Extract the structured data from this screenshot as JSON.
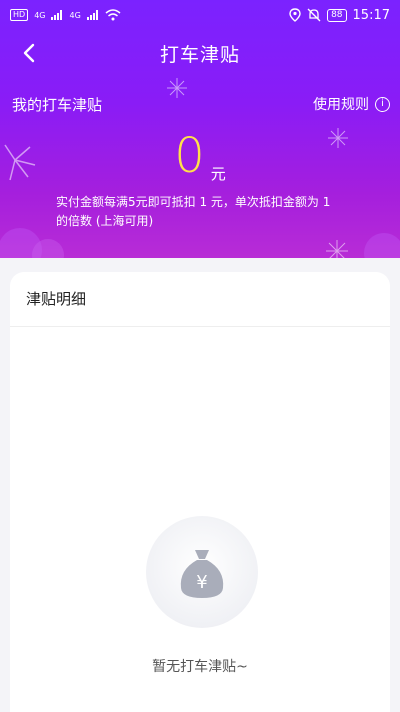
{
  "status_bar": {
    "hd_label": "HD",
    "signal1": "4G",
    "signal2": "4G",
    "battery": "88",
    "time": "15:17"
  },
  "nav": {
    "title": "打车津贴"
  },
  "hero": {
    "section_label": "我的打车津贴",
    "rules_label": "使用规则",
    "amount": "0",
    "unit": "元",
    "description": "实付金额每满5元即可抵扣 1 元，单次抵扣金额为 1 的倍数 (上海可用)"
  },
  "detail": {
    "title": "津贴明细",
    "empty_text": "暂无打车津贴~",
    "currency_symbol": "¥"
  },
  "colors": {
    "accent_gradient_top": "#7b22ff",
    "accent_gradient_bottom": "#b82cd6",
    "amount_color": "#ffe14a"
  },
  "icons": [
    "back-arrow-icon",
    "info-icon",
    "wifi-icon",
    "location-icon",
    "mute-bell-icon",
    "money-bag-icon"
  ]
}
